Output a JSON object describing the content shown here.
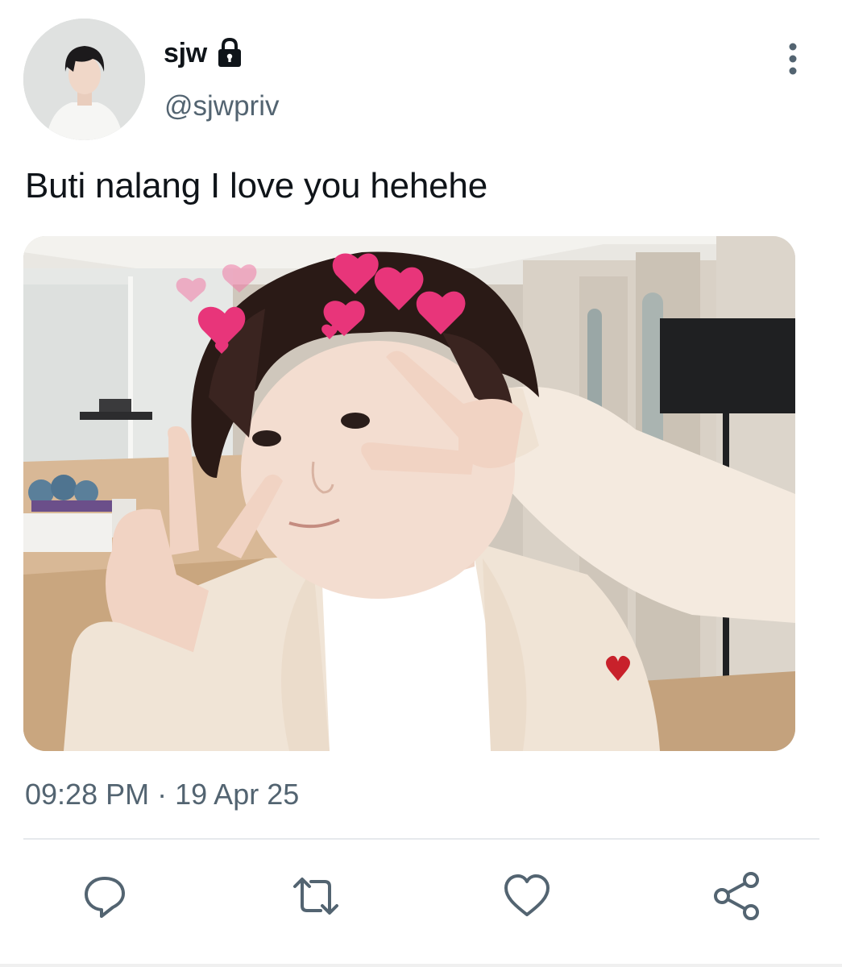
{
  "author": {
    "display_name": "sjw",
    "handle": "@sjwpriv",
    "protected_icon": "lock-icon",
    "avatar_icon": "avatar"
  },
  "tweet": {
    "text": "Buti nalang I love you hehehe",
    "time": "09:28 PM",
    "separator": "·",
    "date": "19 Apr 25"
  },
  "actions": [
    {
      "name": "reply",
      "icon": "reply-icon"
    },
    {
      "name": "retweet",
      "icon": "retweet-icon"
    },
    {
      "name": "like",
      "icon": "heart-icon"
    },
    {
      "name": "share",
      "icon": "share-icon"
    }
  ],
  "menu": {
    "icon": "more-vertical-icon"
  },
  "colors": {
    "text": "#0f1419",
    "secondary_text": "#536471",
    "icon_gray": "#536471",
    "divider": "#e6e9ec",
    "heart_sticker": "#e8357a"
  }
}
